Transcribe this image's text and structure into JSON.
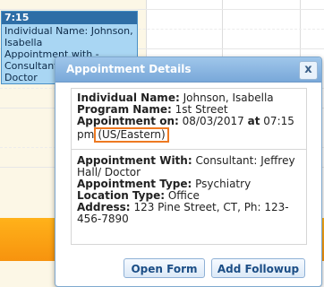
{
  "event": {
    "time": "7:15",
    "lines": [
      "Individual Name: Johnson,",
      "Isabella",
      "Appointment with -",
      "Consultant",
      "Doctor"
    ]
  },
  "dialog": {
    "title": "Appointment Details",
    "close_label": "x",
    "individual": {
      "label": "Individual Name:",
      "value": "Johnson, Isabella"
    },
    "program": {
      "label": "Program Name:",
      "value": "1st Street"
    },
    "appointment_on": {
      "label": "Appointment on:",
      "date": "08/03/2017",
      "at_label": "at",
      "time": "07:15",
      "ampm": "pm",
      "timezone": "(US/Eastern)"
    },
    "appointment_with": {
      "label": "Appointment With:",
      "value_line1": "Consultant: Jeffrey",
      "value_line2": "Hall/ Doctor"
    },
    "appointment_type": {
      "label": "Appointment Type:",
      "value": "Psychiatry"
    },
    "location_type": {
      "label": "Location Type:",
      "value": "Office"
    },
    "address": {
      "label": "Address:",
      "value_line1": "123 Pine Street, CT, Ph: 123-",
      "value_line2": "456-7890"
    },
    "buttons": {
      "open_form": "Open Form",
      "add_followup": "Add Followup"
    }
  },
  "colors": {
    "title_bar": "#8fbbe4",
    "timezone_highlight": "#ee7a22",
    "event_bg": "#a9d6f3",
    "orange_bar": "#f9a316"
  }
}
